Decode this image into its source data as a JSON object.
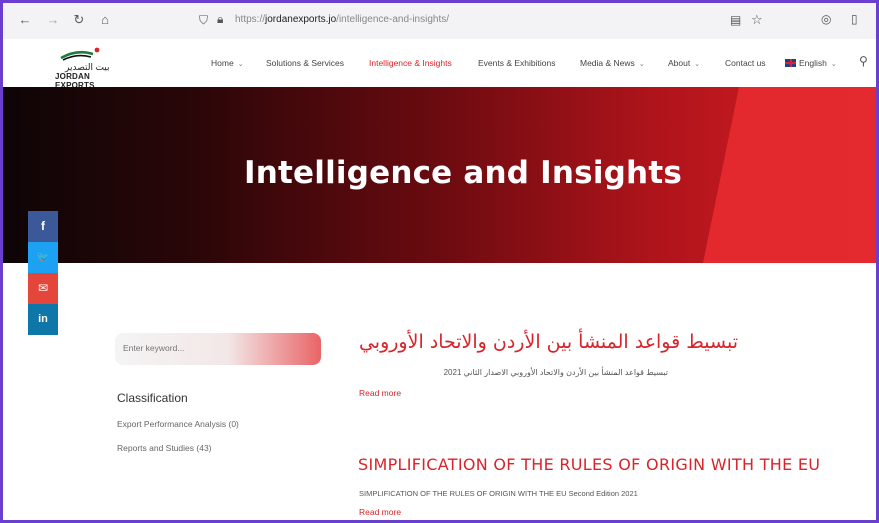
{
  "browser": {
    "url_prefix": "https://",
    "url_domain": "jordanexports.jo",
    "url_path": "/intelligence-and-insights/"
  },
  "site": {
    "logo_ar": "بيت التصدير",
    "logo_en": "JORDAN EXPORTS",
    "nav": [
      {
        "label": "Home",
        "has_menu": true
      },
      {
        "label": "Solutions & Services",
        "has_menu": false
      },
      {
        "label": "Intelligence & Insights",
        "has_menu": false,
        "active": true
      },
      {
        "label": "Events & Exhibitions",
        "has_menu": false
      },
      {
        "label": "Media & News",
        "has_menu": true
      },
      {
        "label": "About",
        "has_menu": true
      },
      {
        "label": "Contact us",
        "has_menu": false
      },
      {
        "label": "English",
        "has_menu": true
      }
    ],
    "accent_color": "#d8242a"
  },
  "hero": {
    "title": "Intelligence and Insights"
  },
  "social": [
    {
      "icon": "facebook-icon",
      "glyph": "f",
      "color": "#3b5998"
    },
    {
      "icon": "twitter-icon",
      "glyph": "🐦",
      "color": "#1da1f2"
    },
    {
      "icon": "email-icon",
      "glyph": "✉",
      "color": "#e4463c"
    },
    {
      "icon": "linkedin-icon",
      "glyph": "in",
      "color": "#0e76a8"
    }
  ],
  "sidebar": {
    "search_placeholder": "Enter keyword...",
    "classification_title": "Classification",
    "items": [
      {
        "label": "Export Performance Analysis (0)"
      },
      {
        "label": "Reports and Studies (43)"
      }
    ]
  },
  "articles": [
    {
      "title": "تبسيط قواعد المنشأ بين الأردن والاتحاد الأوروبي",
      "subtitle": "تبسيط قواعد المنشأ بين الأردن والاتحاد الأوروبي الاصدار الثاني 2021",
      "read_more": "Read more"
    },
    {
      "title": "SIMPLIFICATION OF THE RULES OF ORIGIN WITH THE EU",
      "subtitle": "SIMPLIFICATION OF THE RULES OF ORIGIN WITH THE EU Second Edition 2021",
      "read_more": "Read more"
    }
  ]
}
